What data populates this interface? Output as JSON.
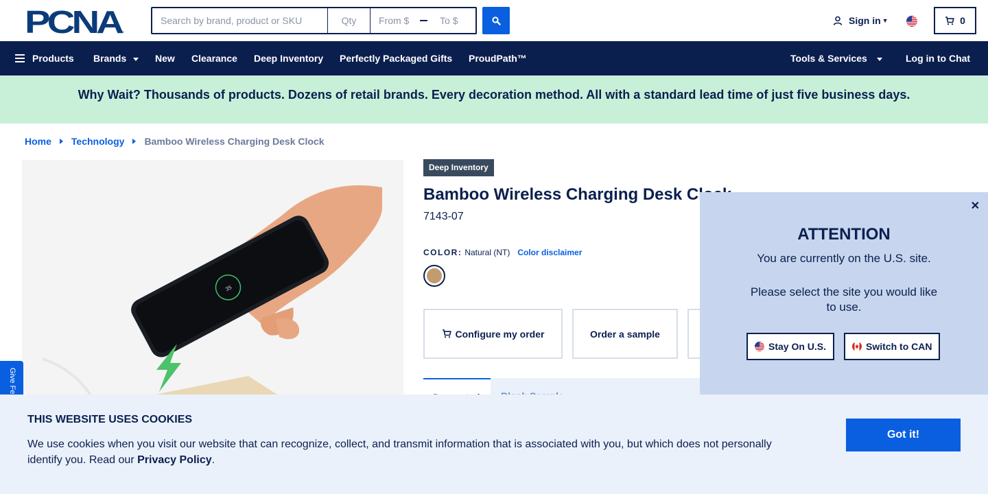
{
  "header": {
    "logo_text": "PCNA",
    "search_placeholder": "Search by brand, product or SKU",
    "qty_placeholder": "Qty",
    "price_from_placeholder": "From $",
    "price_to_placeholder": "To $",
    "signin_label": "Sign in",
    "cart_count": "0"
  },
  "nav": {
    "items": [
      "Products",
      "Brands",
      "New",
      "Clearance",
      "Deep Inventory",
      "Perfectly Packaged Gifts",
      "ProudPath™"
    ],
    "tools_label": "Tools & Services",
    "chat_label": "Log in to Chat"
  },
  "promo": {
    "text": "Why Wait? Thousands of products. Dozens of retail brands. Every decoration method. All with a standard lead time of just five business days."
  },
  "breadcrumb": {
    "home": "Home",
    "category": "Technology",
    "current": "Bamboo Wireless Charging Desk Clock"
  },
  "feedback": {
    "label": "Give Fe"
  },
  "product": {
    "badge": "Deep Inventory",
    "title": "Bamboo Wireless Charging Desk Clock",
    "sku": "7143-07",
    "color_label": "COLOR:",
    "color_value": "Natural (NT)",
    "color_disclaimer": "Color disclaimer",
    "swatch_color": "#c29b6e",
    "actions": {
      "configure": "Configure my order",
      "sample": "Order a sample"
    },
    "tabs": {
      "active": "Decorated",
      "other": "Blank Sample"
    }
  },
  "attention": {
    "title": "ATTENTION",
    "msg1": "You are currently on the U.S. site.",
    "msg2": "Please select the site you would like to use.",
    "stay_label": "Stay On U.S.",
    "switch_label": "Switch to CAN"
  },
  "cookie": {
    "title": "THIS WEBSITE USES COOKIES",
    "text": "We use cookies when you visit our website that can recognize, collect, and transmit information that is associated with you, but which does not personally identify you. Read our",
    "policy_link": "Privacy Policy",
    "button": "Got it!"
  },
  "colors": {
    "navy": "#0b1f4f",
    "blue": "#0a5fe0",
    "promo_bg": "#c8f0d9",
    "cookie_bg": "#eaf1fa",
    "modal_bg": "#c7d6ee"
  }
}
